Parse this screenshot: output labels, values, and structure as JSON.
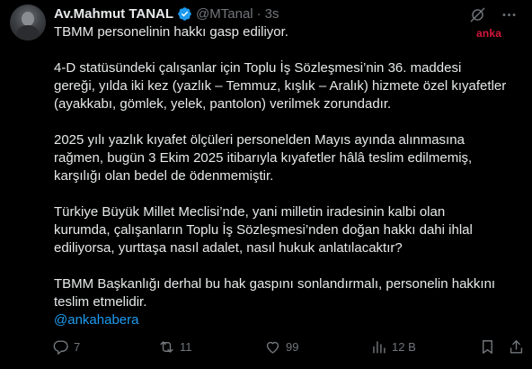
{
  "author": {
    "name": "Av.Mahmut TANAL",
    "handle": "@MTanal",
    "separator": "·",
    "time": "3s"
  },
  "watermark": "anka",
  "body": {
    "line1": "TBMM personelinin hakkı gasp ediliyor.",
    "p2": [
      "4-D statüsündeki çalışanlar için Toplu İş Sözleşmesi’nin 36. maddesi",
      "gereği, yılda iki kez (yazlık – Temmuz, kışlık – Aralık) hizmete özel kıyafetler",
      "(ayakkabı, gömlek, yelek, pantolon) verilmek zorundadır."
    ],
    "p3": [
      "2025 yılı yazlık kıyafet ölçüleri personelden Mayıs ayında alınmasına",
      "rağmen, bugün 3 Ekim 2025 itibarıyla kıyafetler hâlâ teslim edilmemiş,",
      "karşılığı olan bedel de ödenmemiştir."
    ],
    "p4": [
      "Türkiye Büyük Millet Meclisi’nde, yani milletin iradesinin kalbi olan",
      "kurumda, çalışanların Toplu İş Sözleşmesi’nden doğan hakkı dahi ihlal",
      "ediliyorsa, yurttaşa nasıl adalet, nasıl hukuk anlatılacaktır?"
    ],
    "p5": [
      "TBMM Başkanlığı derhal bu hak gaspını sonlandırmalı, personelin hakkını",
      "teslim etmelidir."
    ],
    "mention": "@ankahabera"
  },
  "actions": {
    "replies": "7",
    "reposts": "11",
    "likes": "99",
    "views": "12 B"
  },
  "colors": {
    "background": "#000000",
    "text": "#e7e9ea",
    "muted": "#71767b",
    "accent": "#1d9bf0",
    "watermark": "#d6173b"
  },
  "icons": [
    "verified-badge-icon",
    "grok-icon",
    "more-icon",
    "reply-icon",
    "repost-icon",
    "like-icon",
    "views-icon",
    "bookmark-icon",
    "share-icon"
  ]
}
